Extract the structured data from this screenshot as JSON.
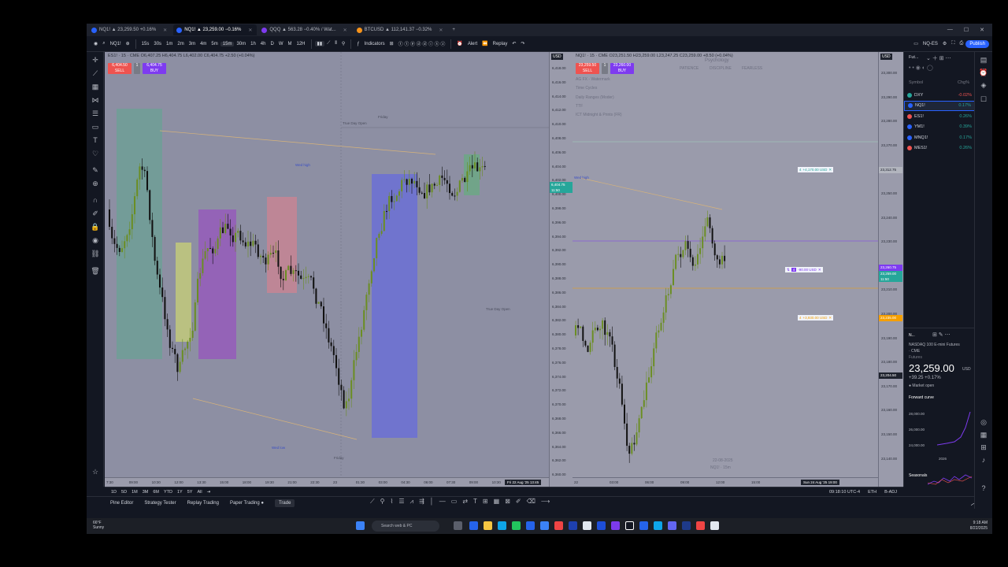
{
  "browser": {
    "tabs": [
      {
        "label": "NQ1! ▲ 23,259.50 +0.16%",
        "active": false
      },
      {
        "label": "NQ1! ▲ 23,259.00 −0.16%",
        "active": true
      },
      {
        "label": "QQQ ▲ 563.28 −0.40% / Wat...",
        "active": false
      },
      {
        "label": "BTCUSD ▲ 112,141.37 −0.32%",
        "active": false
      }
    ]
  },
  "toolbar": {
    "symbol": "NQ1!",
    "intervals": [
      "15s",
      "30s",
      "1m",
      "2m",
      "3m",
      "4m",
      "5m",
      "15m",
      "30m",
      "1h",
      "4h",
      "D",
      "W",
      "M",
      "12H"
    ],
    "selected_interval": "15m",
    "indicators_label": "Indicators",
    "alert_label": "Alert",
    "replay_label": "Replay",
    "layout_label": "NQ-ES",
    "publish_label": "Publish"
  },
  "left_chart": {
    "header": "ES1! · 15 · CME  O6,407.25 H6,404.75 L6,402.00 C6,404.75 +2.50 (+0.04%)",
    "sell_price": "6,404.50",
    "sell_label": "SELL",
    "buy_price": "6,404.75",
    "buy_label": "BUY",
    "currency": "USD",
    "price_ticks": [
      "6,418.00",
      "6,416.00",
      "6,414.00",
      "6,412.00",
      "6,410.00",
      "6,408.00",
      "6,406.00",
      "6,404.00",
      "6,402.00",
      "6,400.00",
      "6,398.00",
      "6,396.00",
      "6,394.00",
      "6,392.00",
      "6,390.00",
      "6,388.00",
      "6,386.00",
      "6,384.00",
      "6,382.00",
      "6,380.00",
      "6,378.00",
      "6,376.00",
      "6,374.00",
      "6,372.00",
      "6,370.00",
      "6,368.00",
      "6,366.00",
      "6,364.00",
      "6,362.00",
      "6,360.00"
    ],
    "current_price": "6,404.75",
    "countdown": "11:50",
    "time_ticks": [
      "7:30",
      "09:00",
      "10:30",
      "12:00",
      "13:30",
      "15:00",
      "18:00",
      "19:30",
      "21:00",
      "22:30",
      "23",
      "01:30",
      "03:00",
      "04:30",
      "06:00",
      "07:30",
      "09:00",
      "10:30"
    ],
    "cursor_time": "Fri 22 Aug '25  13:45",
    "annotations": {
      "true_day_open": "True Day Open",
      "friday": "Friday",
      "wed_high": "Wed high",
      "wed_low": "Wed low",
      "friday_low": "Friday",
      "true_day_open_2": "True Day Open"
    }
  },
  "right_chart": {
    "header": "NQ1! · 15 · CME  O23,251.50 H23,259.00 L23,247.25 C23,259.00 +8.50 (+0.04%)",
    "sell_price": "23,259.50",
    "sell_label": "SELL",
    "buy_price": "23,260.00",
    "buy_label": "BUY",
    "currency": "USD",
    "watermark_lines": [
      "AG FX - Watermark",
      "Time Cycles",
      "Daily Ranges (Moder)",
      "TTF",
      "ICT Midnight & Prints (FR)"
    ],
    "psychology": "Psychology",
    "psych_words": [
      "PATIENCE",
      "DISCIPLINE",
      "FEARLESS"
    ],
    "price_ticks": [
      "23,300.00",
      "23,290.00",
      "23,280.00",
      "23,270.00",
      "23,260.00",
      "23,250.00",
      "23,240.00",
      "23,230.00",
      "23,220.00",
      "23,210.00",
      "23,200.00",
      "23,190.00",
      "23,180.00",
      "23,170.00",
      "23,160.00",
      "23,150.00",
      "23,140.00"
    ],
    "current_price": "23,259.00",
    "countdown": "11:50",
    "tp_label": "+4,170.00 USD",
    "tp_qty": "4",
    "entry_label": "-90.00 USD",
    "entry_qty": "4",
    "sl_label": "+3,930.00 USD",
    "sl_qty": "4",
    "tp_price": "23,312.75",
    "entry_price": "23,260.75",
    "sl_price": "23,235.00",
    "crosshair_price": "23,204.50",
    "wed_high": "Wed high",
    "time_ticks": [
      "22",
      "03:00",
      "06:00",
      "09:00",
      "12:00",
      "15:00"
    ],
    "cursor_time": "Sun 24 Aug '25  19:00",
    "bottom_watermark": "22-08-2025",
    "bottom_watermark_2": "NQ1! · 15m"
  },
  "range_bar": {
    "ranges": [
      "1D",
      "5D",
      "1M",
      "3M",
      "6M",
      "YTD",
      "1Y",
      "5Y",
      "All"
    ],
    "clock": "09:18:10 UTC-4",
    "session": "ETH",
    "adj": "B-ADJ"
  },
  "bottom_bar": {
    "items": [
      "Pine Editor",
      "Strategy Tester",
      "Replay Trading",
      "Paper Trading ●",
      "Trade"
    ]
  },
  "watchlist": {
    "title": "Fut...",
    "col_symbol": "Symbol",
    "col_change": "Chg%",
    "rows": [
      {
        "symbol": "DXY",
        "change": "-0.02%",
        "dir": "neg",
        "color": "#26a69a"
      },
      {
        "symbol": "NQ1!",
        "change": "0.17%",
        "dir": "pos",
        "color": "#2962ff",
        "selected": true
      },
      {
        "symbol": "ES1!",
        "change": "0.26%",
        "dir": "pos",
        "color": "#ef5350"
      },
      {
        "symbol": "YM1!",
        "change": "0.39%",
        "dir": "pos",
        "color": "#2962ff"
      },
      {
        "symbol": "MNQ1!",
        "change": "0.17%",
        "dir": "pos",
        "color": "#2962ff"
      },
      {
        "symbol": "MES1!",
        "change": "0.26%",
        "dir": "pos",
        "color": "#ef5350"
      }
    ]
  },
  "details": {
    "short": "N...",
    "name": "NASDAQ 100 E-mini Futures",
    "exchange": "· CME",
    "type": "Futures",
    "price": "23,259.00",
    "currency": "USD",
    "change": "+39.25  +0.17%",
    "status": "● Market open",
    "forward_curve": "Forward curve",
    "curve_ticks": [
      "28,000.00",
      "26,000.00",
      "24,000.00"
    ],
    "curve_year": "2026",
    "seasonals": "Seasonals"
  },
  "taskbar": {
    "weather_temp": "66°F",
    "weather_desc": "Sunny",
    "search_placeholder": "Search web & PC",
    "time": "9:18 AM",
    "date": "8/22/2025"
  }
}
